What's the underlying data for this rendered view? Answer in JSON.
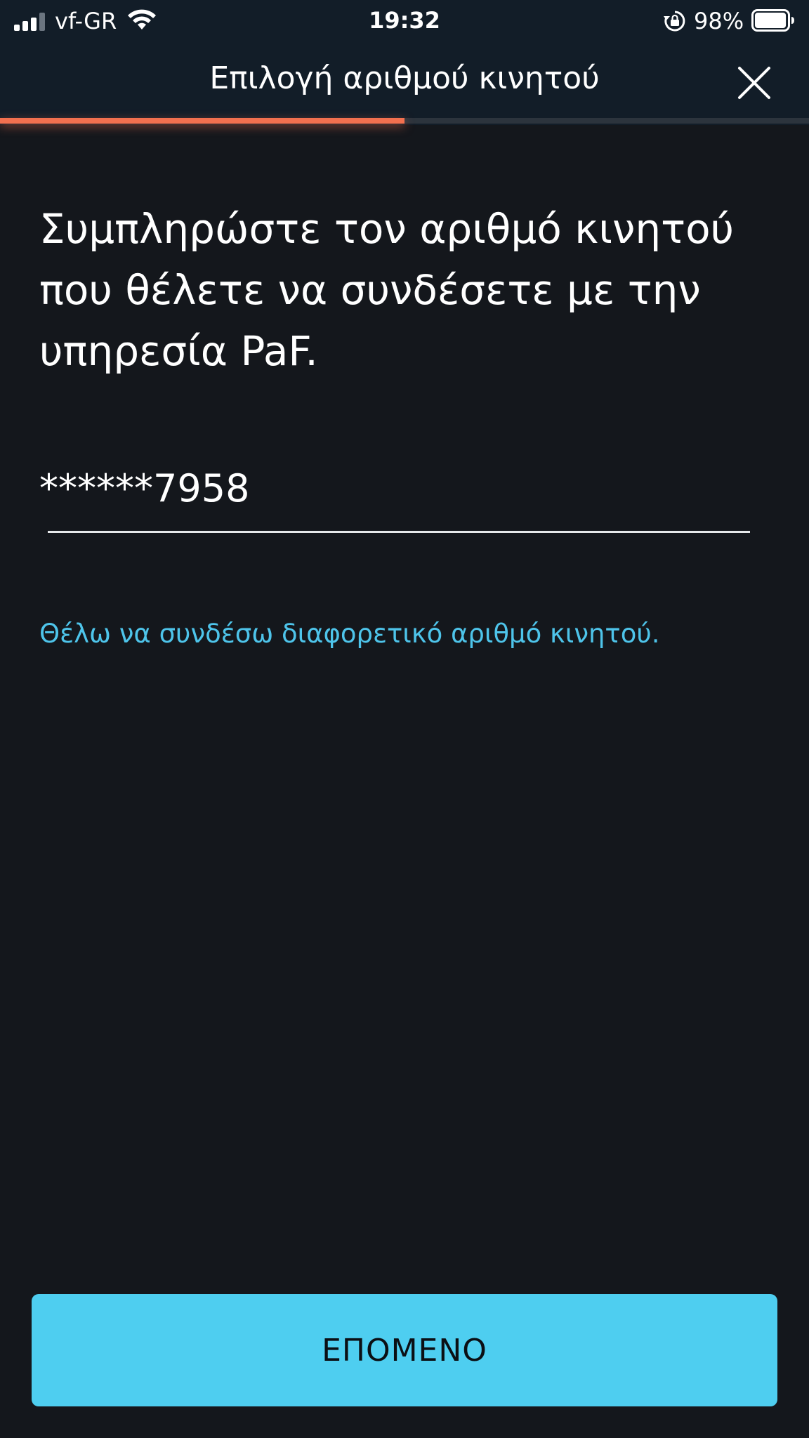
{
  "status_bar": {
    "carrier": "vf-GR",
    "time": "19:32",
    "battery_percent_label": "98%",
    "battery_level": 0.98,
    "signal_bars_active": 3,
    "signal_bars_total": 4,
    "icons": [
      "signal-icon",
      "wifi-icon",
      "orientation-lock-icon",
      "battery-icon"
    ]
  },
  "header": {
    "title": "Επιλογή αριθμού κινητού",
    "close_icon": "close-icon",
    "progress_fraction": 0.5,
    "progress_color": "#f2704f"
  },
  "main": {
    "heading": "Συμπληρώστε τον αριθμό κινητού που θέλετε να συνδέσετε με την υπηρεσία PaF.",
    "phone_value": "******7958",
    "alt_link": "Θέλω να συνδέσω διαφορετικό αριθμό κινητού."
  },
  "footer": {
    "next_label": "ΕΠΟΜΕΝΟ"
  },
  "colors": {
    "background": "#14171c",
    "header_background": "#121d28",
    "accent": "#4ecef0",
    "link": "#4ec4ea"
  }
}
